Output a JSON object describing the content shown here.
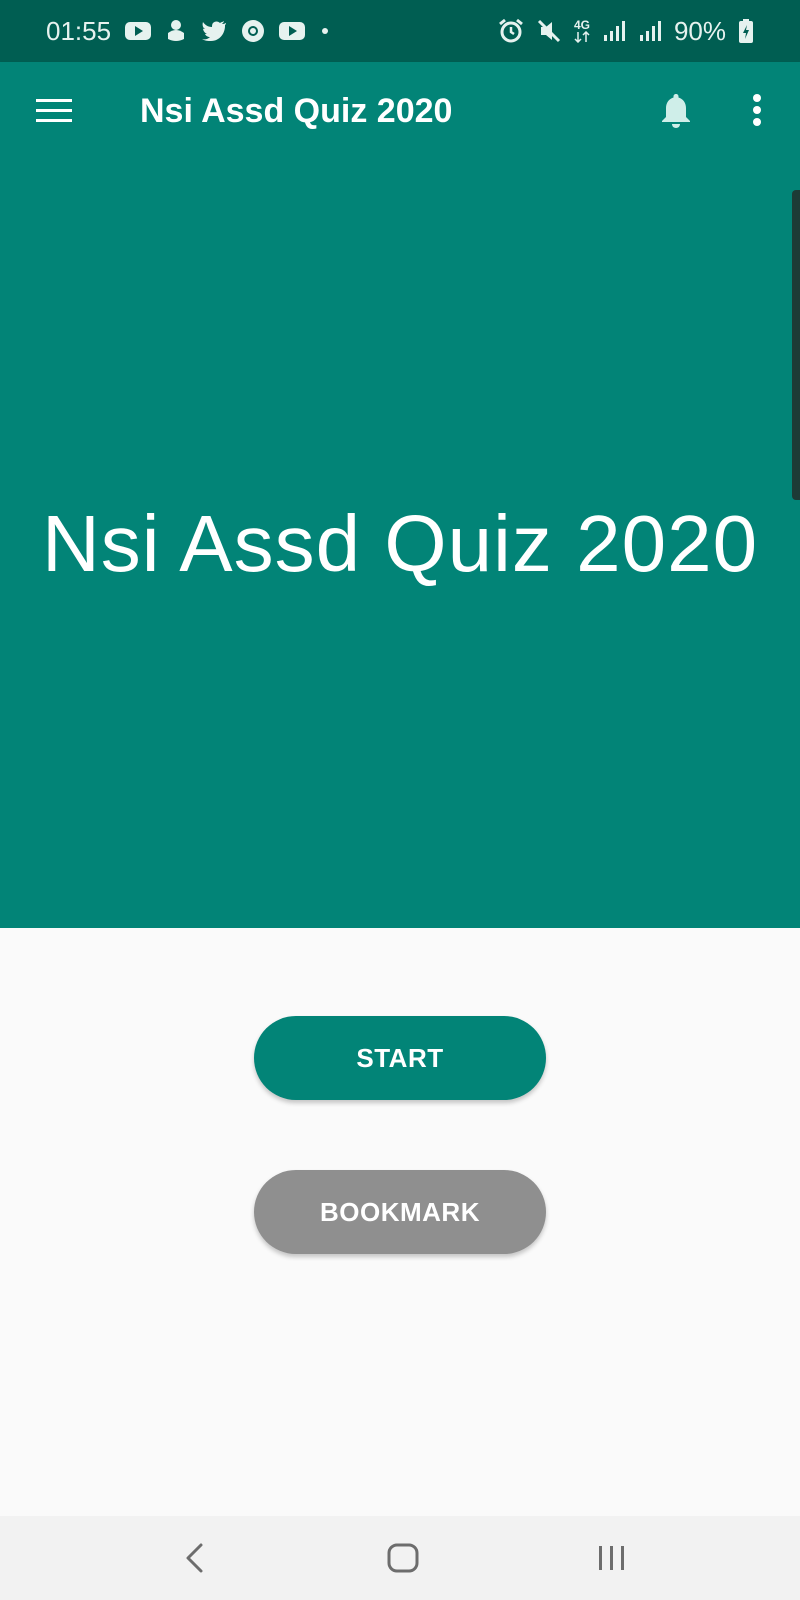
{
  "status_bar": {
    "time": "01:55",
    "battery": "90%",
    "network": "4G",
    "left_icons": [
      "youtube-icon",
      "download-icon",
      "twitter-icon",
      "chrome-icon",
      "youtube-icon",
      "dot-icon"
    ],
    "right_icons": [
      "alarm-icon",
      "mute-icon",
      "4g-icon",
      "signal-icon",
      "signal-icon",
      "battery-icon"
    ]
  },
  "app_bar": {
    "title": "Nsi Assd Quiz 2020",
    "icons": [
      "hamburger-menu-icon",
      "bell-icon",
      "more-vert-icon"
    ]
  },
  "hero": {
    "title": "Nsi Assd Quiz 2020"
  },
  "actions": {
    "start_label": "START",
    "bookmark_label": "BOOKMARK"
  },
  "nav_bar": {
    "icons": [
      "back-icon",
      "home-icon",
      "recents-icon"
    ]
  },
  "colors": {
    "primary": "#028477",
    "primary_dark": "#005e52",
    "bookmark_gray": "#8f8f8f",
    "background": "#fafafa"
  }
}
